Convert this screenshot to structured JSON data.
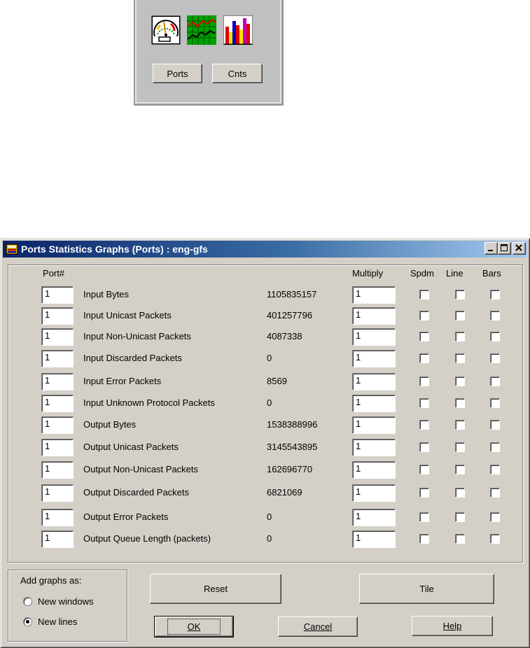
{
  "toolbar": {
    "icons": [
      "gauge-icon",
      "line-chart-icon",
      "bar-chart-icon"
    ],
    "ports_button": "Ports",
    "cnts_button": "Cnts"
  },
  "dialog": {
    "title": "Ports Statistics Graphs (Ports) : eng-gfs",
    "columns": {
      "port": "Port#",
      "multiply": "Multiply",
      "spdm": "Spdm",
      "line": "Line",
      "bars": "Bars"
    },
    "rows": [
      {
        "port": "1",
        "label": "Input Bytes",
        "value": "1105835157",
        "multiply": "1",
        "spdm": false,
        "line": false,
        "bars": false
      },
      {
        "port": "1",
        "label": "Input Unicast Packets",
        "value": "401257796",
        "multiply": "1",
        "spdm": false,
        "line": false,
        "bars": false
      },
      {
        "port": "1",
        "label": "Input Non-Unicast Packets",
        "value": "4087338",
        "multiply": "1",
        "spdm": false,
        "line": false,
        "bars": false
      },
      {
        "port": "1",
        "label": "Input Discarded Packets",
        "value": "0",
        "multiply": "1",
        "spdm": false,
        "line": false,
        "bars": false
      },
      {
        "port": "1",
        "label": "Input Error Packets",
        "value": "8569",
        "multiply": "1",
        "spdm": false,
        "line": false,
        "bars": false
      },
      {
        "port": "1",
        "label": "Input Unknown Protocol Packets",
        "value": "0",
        "multiply": "1",
        "spdm": false,
        "line": false,
        "bars": false
      },
      {
        "port": "1",
        "label": "Output Bytes",
        "value": "1538388996",
        "multiply": "1",
        "spdm": false,
        "line": false,
        "bars": false
      },
      {
        "port": "1",
        "label": "Output Unicast Packets",
        "value": "3145543895",
        "multiply": "1",
        "spdm": false,
        "line": false,
        "bars": false
      },
      {
        "port": "1",
        "label": "Output Non-Unicast Packets",
        "value": "162696770",
        "multiply": "1",
        "spdm": false,
        "line": false,
        "bars": false
      },
      {
        "port": "1",
        "label": "Output Discarded Packets",
        "value": "6821069",
        "multiply": "1",
        "spdm": false,
        "line": false,
        "bars": false
      },
      {
        "port": "1",
        "label": "Output Error Packets",
        "value": "0",
        "multiply": "1",
        "spdm": false,
        "line": false,
        "bars": false
      },
      {
        "port": "1",
        "label": "Output Queue Length (packets)",
        "value": "0",
        "multiply": "1",
        "spdm": false,
        "line": false,
        "bars": false
      }
    ],
    "add_graphs": {
      "title": "Add graphs as:",
      "options": [
        "New windows",
        "New lines"
      ],
      "selected": "New lines"
    },
    "buttons": {
      "reset": "Reset",
      "tile": "Tile",
      "ok": "OK",
      "cancel": "Cancel",
      "help": "Help"
    }
  }
}
